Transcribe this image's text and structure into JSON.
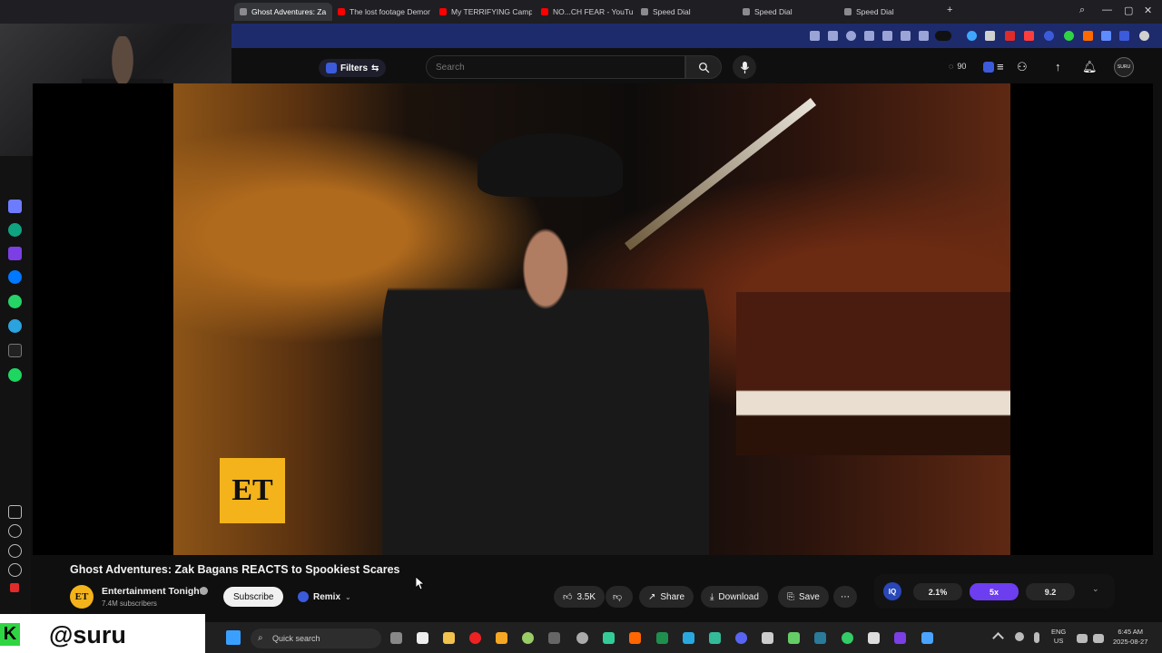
{
  "tabs": [
    {
      "title": "Ghost Adventures: Za",
      "active": true
    },
    {
      "title": "The lost footage Demon h",
      "active": false
    },
    {
      "title": "My TERRIFYING Camping",
      "active": false
    },
    {
      "title": "NO...CH FEAR - YouTube",
      "active": false
    },
    {
      "title": "Speed Dial",
      "active": false
    },
    {
      "title": "Speed Dial",
      "active": false
    },
    {
      "title": "Speed Dial",
      "active": false
    }
  ],
  "masthead": {
    "filters_label": "Filters",
    "search_placeholder": "Search",
    "counter": "90",
    "avatar_text": "SURU"
  },
  "video": {
    "title": "Ghost Adventures: Zak Bagans REACTS to Spookiest Scares",
    "logo_text": "ET"
  },
  "channel": {
    "name": "Entertainment Tonight",
    "subscribers": "7.4M subscribers",
    "avatar_text": "ET",
    "subscribe_label": "Subscribe",
    "remix_label": "Remix"
  },
  "actions": {
    "likes": "3.5K",
    "share": "Share",
    "download": "Download",
    "save": "Save"
  },
  "speed_panel": {
    "logo": "IQ",
    "options": [
      "2.1%",
      "5x",
      "9.2"
    ],
    "selected_index": 1
  },
  "taskbar": {
    "search_label": "Quick search",
    "lang_line1": "ENG",
    "lang_line2": "US",
    "time": "6:45 AM",
    "date": "2025-08-27"
  },
  "watermark": {
    "badge": "K",
    "handle": "@suru"
  },
  "colors": {
    "accent_purple": "#6d3df0",
    "toolbar_blue": "#1d2a6b",
    "et_yellow": "#f4b31a",
    "kick_green": "#2fd443"
  }
}
